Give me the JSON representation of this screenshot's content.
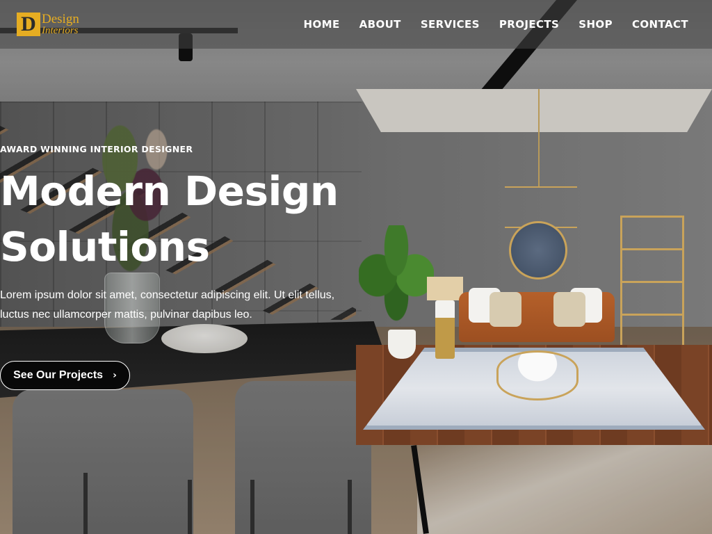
{
  "logo": {
    "mark": "D",
    "line1": "Design",
    "line2": "Interiors"
  },
  "nav": [
    {
      "label": "HOME"
    },
    {
      "label": "ABOUT"
    },
    {
      "label": "SERVICES"
    },
    {
      "label": "PROJECTS"
    },
    {
      "label": "SHOP"
    },
    {
      "label": "CONTACT"
    }
  ],
  "hero": {
    "eyebrow": "AWARD WINNING INTERIOR DESIGNER",
    "headline_line1": "Modern Design",
    "headline_line2": "Solutions",
    "description": "Lorem ipsum dolor sit amet, consectetur adipiscing elit. Ut elit tellus, luctus nec ullamcorper mattis, pulvinar dapibus leo.",
    "cta_label": "See Our Projects",
    "cta_icon": "chevron-right-icon"
  },
  "colors": {
    "brand": "#e6ad22",
    "header_bg": "rgba(70,70,70,0.55)",
    "text": "#ffffff"
  }
}
